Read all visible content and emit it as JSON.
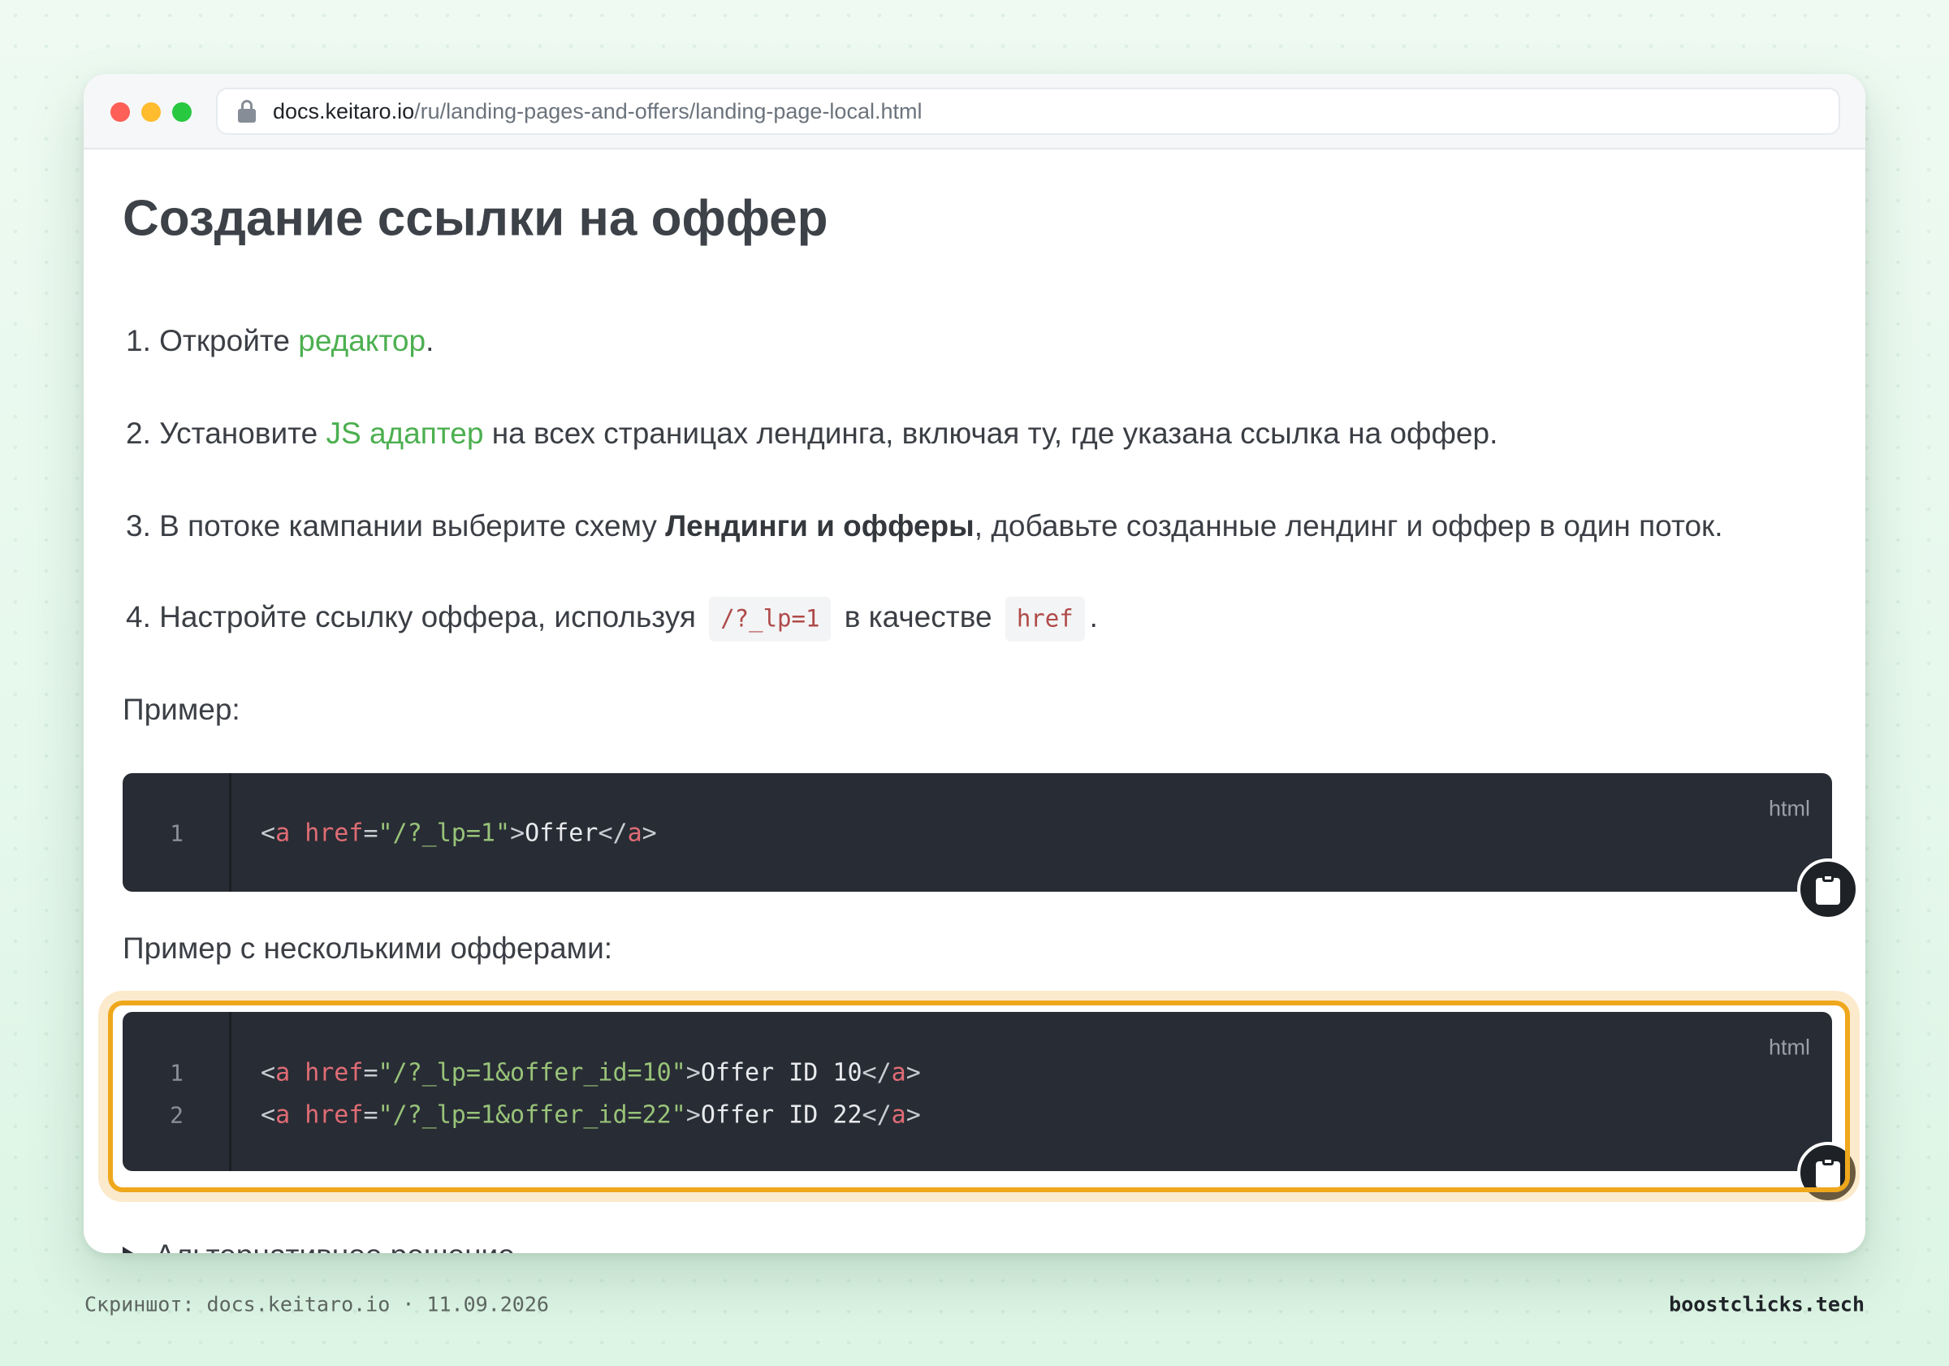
{
  "browser": {
    "url_host": "docs.keitaro.io",
    "url_path": "/ru/landing-pages-and-offers/landing-page-local.html"
  },
  "page": {
    "heading": "Создание ссылки на оффер",
    "steps": [
      {
        "num": "1.",
        "pre": "Откройте ",
        "link": "редактор",
        "post": "."
      },
      {
        "num": "2.",
        "pre": "Установите ",
        "link": "JS адаптер",
        "post": " на всех страницах лендинга, включая ту, где указана ссылка на оффер."
      },
      {
        "num": "3.",
        "pre": "В потоке кампании выберите схему ",
        "bold": "Лендинги и офферы",
        "post": ", добавьте созданные лендинг и оффер в один поток."
      },
      {
        "num": "4.",
        "pre": "Настройте ссылку оффера, используя ",
        "code1": "/?_lp=1",
        "mid": " в качестве ",
        "code2": "href",
        "post": "."
      }
    ],
    "example_label": "Пример:",
    "example_multi_label": "Пример с несколькими офферами:",
    "details_summary": "Альтернативное решение"
  },
  "code_blocks": [
    {
      "language": "html",
      "lines": [
        {
          "num": "1",
          "tag_open": "a",
          "attr": "href",
          "value": "\"/?_lp=1\"",
          "text": "Offer",
          "tag_close": "a"
        }
      ]
    },
    {
      "language": "html",
      "lines": [
        {
          "num": "1",
          "tag_open": "a",
          "attr": "href",
          "value": "\"/?_lp=1&offer_id=10\"",
          "text": "Offer ID 10",
          "tag_close": "a"
        },
        {
          "num": "2",
          "tag_open": "a",
          "attr": "href",
          "value": "\"/?_lp=1&offer_id=22\"",
          "text": "Offer ID 22",
          "tag_close": "a"
        }
      ]
    }
  ],
  "footer": {
    "caption": "Скриншот: docs.keitaro.io · 11.09.2026",
    "brand": "boostclicks.tech"
  },
  "colors": {
    "accent_link": "#4caf50",
    "highlight": "#efa71c",
    "code_bg": "#282c34"
  }
}
